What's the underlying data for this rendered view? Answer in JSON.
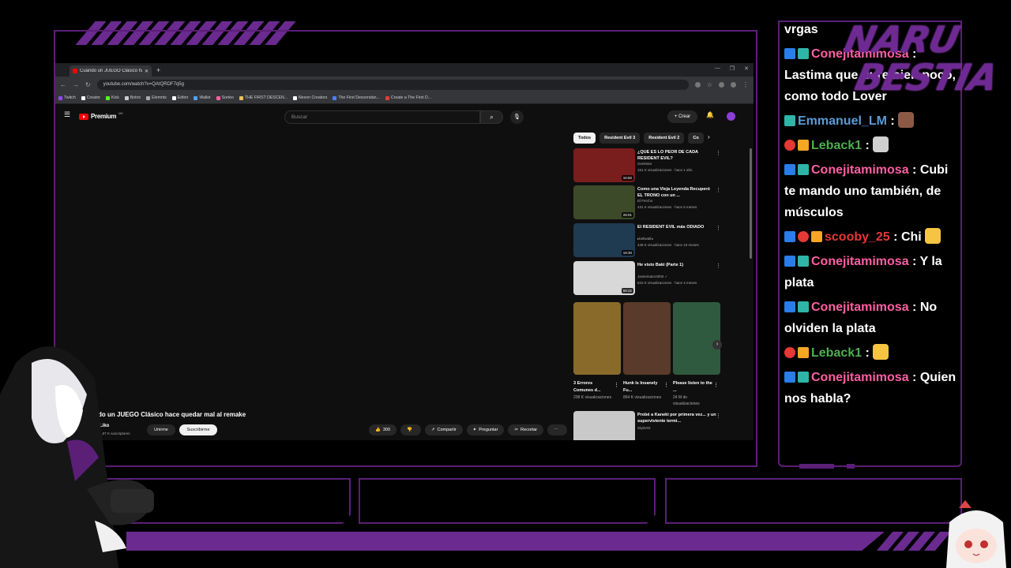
{
  "overlay": {
    "logo_line1": "NARU",
    "logo_line2": "BESTIA",
    "accent": "#6a2a8f"
  },
  "browser": {
    "tab_title": "Cuando un JUEGO Clásico hace",
    "new_tab": "+",
    "url": "youtube.com/watch?v=QAtQRDF7q5g",
    "bookmarks": [
      {
        "label": "Twitch",
        "color": "#9146ff"
      },
      {
        "label": "Creator",
        "color": "#ffffff"
      },
      {
        "label": "Kick",
        "color": "#53fc18"
      },
      {
        "label": "Botrix",
        "color": "#cccccc"
      },
      {
        "label": "Elemnts",
        "color": "#aaaaaa"
      },
      {
        "label": "Editor",
        "color": "#ffffff"
      },
      {
        "label": "Wallet",
        "color": "#4aa3ff"
      },
      {
        "label": "Sorteo",
        "color": "#ff5fa2"
      },
      {
        "label": "THE FIRST DESCEN...",
        "color": "#e7c35a"
      },
      {
        "label": "Nexon Creators",
        "color": "#ffffff"
      },
      {
        "label": "The First Descendan...",
        "color": "#4a7dff"
      },
      {
        "label": "Create a The First D...",
        "color": "#e53935"
      }
    ]
  },
  "youtube": {
    "logo_label": "Premium",
    "logo_sup": "MX",
    "search_placeholder": "Buscar",
    "create_label": "+ Crear",
    "video_title": "do un JUEGO Clásico hace quedar mal al remake",
    "channel_name": "Liko",
    "subscribers": "4,07 K suscriptores",
    "join_label": "Unirme",
    "subscribe_label": "Suscribirme",
    "actions": [
      {
        "icon": "👍",
        "label": "300"
      },
      {
        "icon": "👎",
        "label": ""
      },
      {
        "icon": "↗",
        "label": "Compartir"
      },
      {
        "icon": "✦",
        "label": "Preguntar"
      },
      {
        "icon": "✂",
        "label": "Recortar"
      },
      {
        "icon": "⋯",
        "label": ""
      }
    ],
    "chips": [
      "Todos",
      "Resident Evil 3",
      "Resident Evil 2",
      "Co"
    ],
    "recommendations": [
      {
        "title": "¿QUE ES LO PEOR DE CADA RESIDENT EVIL?",
        "channel": "Geekstar",
        "stats": "151 K visualizaciones · hace 1 año",
        "duration": "16:50",
        "color": "#7a1d1d"
      },
      {
        "title": "Como una Vieja Leyenda Recuperó EL TRONO con un ...",
        "channel": "El Fercho",
        "stats": "431 K visualizaciones · hace 5 meses",
        "duration": "28:01",
        "color": "#3d4a2a"
      },
      {
        "title": "El RESIDENT EVIL más ODIADO",
        "channel": "▸beltwall◂",
        "stats": "448 K visualizaciones · hace 10 meses",
        "duration": "19:30",
        "color": "#1f3b52"
      },
      {
        "title": "He visto Baki (Parte 1)",
        "channel": "Javierinator3000 ✓",
        "stats": "615 K visualizaciones · hace 4 meses",
        "duration": "59:32",
        "color": "#d8d8d8"
      },
      {
        "title": "Probé a Kaneki por primera vez... y un superviviente termi...",
        "channel": "Styler02",
        "stats": "",
        "duration": "",
        "color": "#c9c9c9"
      }
    ],
    "shorts": [
      {
        "title": "3 Errores Comunes d...",
        "views": "208 K visualizaciones",
        "color": "#8a6a2a"
      },
      {
        "title": "Hunk Is Insanely Fu...",
        "views": "864 K visualizaciones",
        "color": "#5a3a2a"
      },
      {
        "title": "Please listen to the ...",
        "views": "24 M de visualizaciones",
        "color": "#2f5a3f"
      }
    ]
  },
  "chat": {
    "messages": [
      {
        "badges": [],
        "user": "",
        "user_color": "#ffffff",
        "text": "vrgas",
        "emote": ""
      },
      {
        "badges": [
          "#2b7de9",
          "#2fb5a8"
        ],
        "user": "Conejitamimosa",
        "user_color": "#ff5fa2",
        "text": "Lastima que dure bien poco, como todo Lover",
        "emote": ""
      },
      {
        "badges": [
          "#2fb5a8"
        ],
        "user": "Emmanuel_LM",
        "user_color": "#5b9bd5",
        "text": "",
        "emote": "#8c5a44"
      },
      {
        "badges": [
          "#e53935",
          "#f5a623"
        ],
        "user": "Leback1",
        "user_color": "#4caf50",
        "text": "",
        "emote": "#d0d0d0"
      },
      {
        "badges": [
          "#2b7de9",
          "#2fb5a8"
        ],
        "user": "Conejitamimosa",
        "user_color": "#ff5fa2",
        "text": "Cubi te mando uno también, de músculos",
        "emote": ""
      },
      {
        "badges": [
          "#2b7de9",
          "#e53935",
          "#f5a623"
        ],
        "user": "scooby_25",
        "user_color": "#e53935",
        "text": "Chi",
        "emote": "#f5c542"
      },
      {
        "badges": [
          "#2b7de9",
          "#2fb5a8"
        ],
        "user": "Conejitamimosa",
        "user_color": "#ff5fa2",
        "text": "Y la plata",
        "emote": ""
      },
      {
        "badges": [
          "#2b7de9",
          "#2fb5a8"
        ],
        "user": "Conejitamimosa",
        "user_color": "#ff5fa2",
        "text": "No olviden la plata",
        "emote": ""
      },
      {
        "badges": [
          "#e53935",
          "#f5a623"
        ],
        "user": "Leback1",
        "user_color": "#4caf50",
        "text": "",
        "emote": "#f5c542"
      },
      {
        "badges": [
          "#2b7de9",
          "#2fb5a8"
        ],
        "user": "Conejitamimosa",
        "user_color": "#ff5fa2",
        "text": "Quien nos habla?",
        "emote": ""
      }
    ]
  }
}
